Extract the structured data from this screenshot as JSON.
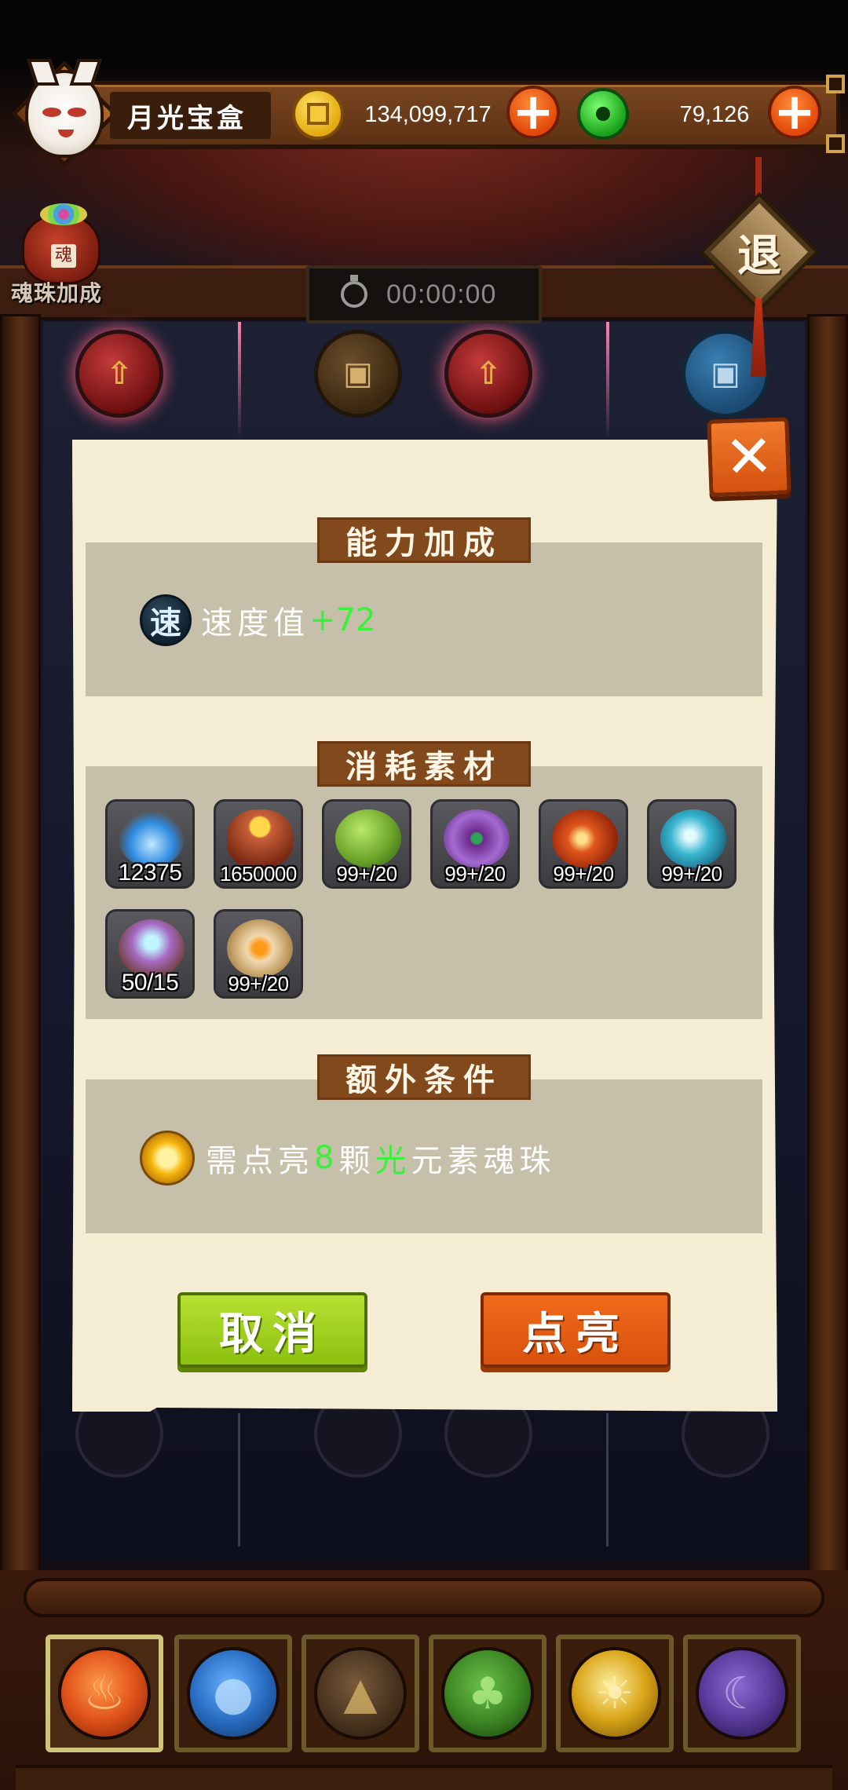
{
  "player": {
    "name": "月光宝盒"
  },
  "currency": {
    "gold": {
      "value": "134,099,717",
      "icon": "gold-coin-icon"
    },
    "jade": {
      "value": "79,126",
      "icon": "jade-coin-icon"
    },
    "add_glyph": "+"
  },
  "header": {
    "bonus_label": "魂珠加成",
    "bag_glyph": "魂",
    "timer": "00:00:00",
    "exit_label": "退"
  },
  "dialog": {
    "close_glyph": "✕",
    "ability": {
      "title": "能力加成",
      "icon_glyph": "速",
      "stat_label": "速度值",
      "stat_value": "+72"
    },
    "materials": {
      "title": "消耗素材",
      "items": [
        {
          "name": "blue-flame",
          "count": "12375",
          "color": "#2f8be0"
        },
        {
          "name": "gold-bag",
          "count": "1650000",
          "color": "#c9603a"
        },
        {
          "name": "clover-orb",
          "count": "99+/20",
          "color": "#6da62b"
        },
        {
          "name": "peacock-orb",
          "count": "99+/20",
          "color": "#8a4fb8"
        },
        {
          "name": "fire-heart-orb",
          "count": "99+/20",
          "color": "#e0551c"
        },
        {
          "name": "ice-crystal-orb",
          "count": "99+/20",
          "color": "#38b6cf"
        },
        {
          "name": "spirit-chest",
          "count": "50/15",
          "color": "#a56ac2"
        },
        {
          "name": "amber-gem-orb",
          "count": "99+/20",
          "color": "#c8a46b"
        }
      ]
    },
    "condition": {
      "title": "额外条件",
      "prefix": "需点亮",
      "count": "8",
      "unit": "颗",
      "element": "光",
      "suffix": "元素魂珠"
    },
    "buttons": {
      "cancel": "取消",
      "confirm": "点亮"
    }
  },
  "element_tabs": [
    {
      "name": "fire",
      "icon": "flame-icon",
      "color": "#e0521a",
      "active": true
    },
    {
      "name": "water",
      "icon": "water-drop-icon",
      "color": "#2a6fc4",
      "active": false
    },
    {
      "name": "earth",
      "icon": "mountain-icon",
      "color": "#8b6a2e",
      "active": false
    },
    {
      "name": "wood",
      "icon": "leaf-icon",
      "color": "#3f8a25",
      "active": false
    },
    {
      "name": "light",
      "icon": "sun-icon",
      "color": "#d9a418",
      "active": false
    },
    {
      "name": "dark",
      "icon": "moon-icon",
      "color": "#5a3a9a",
      "active": false
    }
  ]
}
